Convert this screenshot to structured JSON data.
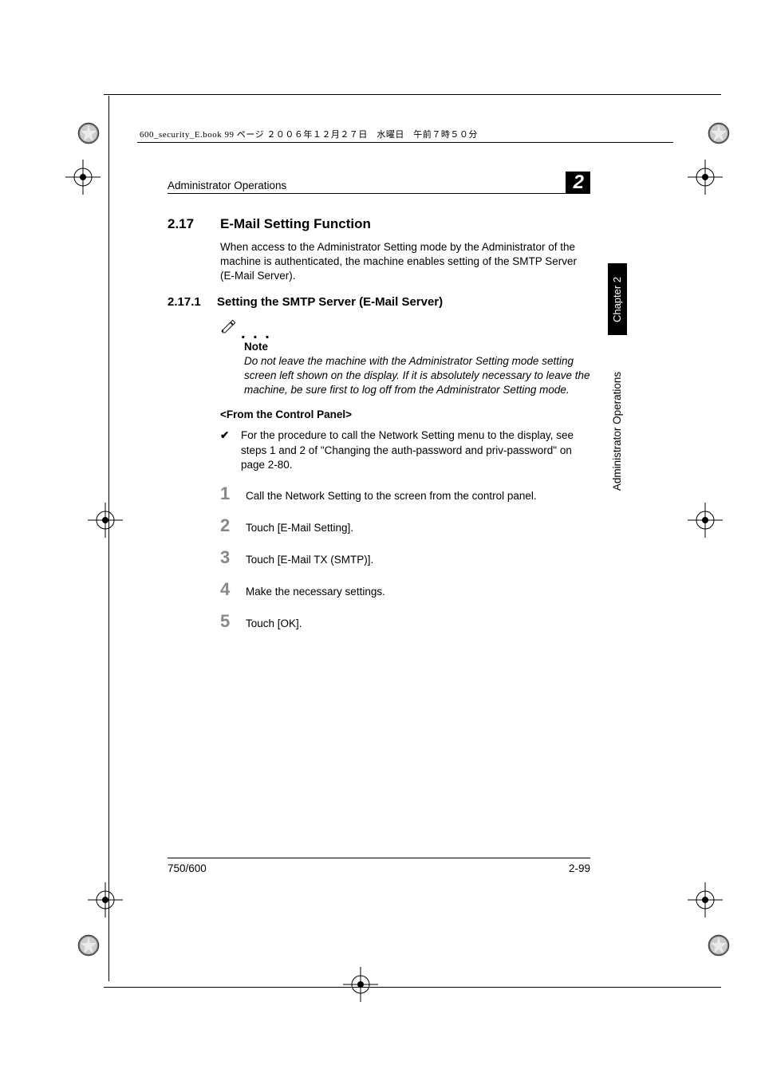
{
  "filename_line": "600_security_E.book  99 ページ  ２００６年１２月２７日　水曜日　午前７時５０分",
  "header": {
    "title": "Administrator Operations",
    "chapter_num": "2"
  },
  "section": {
    "num": "2.17",
    "title": "E-Mail Setting Function",
    "intro": "When access to the Administrator Setting mode by the Administrator of the machine is authenticated, the machine enables setting of the SMTP Server (E-Mail Server)."
  },
  "subsection": {
    "num": "2.17.1",
    "title": "Setting the SMTP Server (E-Mail Server)"
  },
  "note": {
    "label": "Note",
    "body": "Do not leave the machine with the Administrator Setting mode setting screen left shown on the display. If it is absolutely necessary to leave the machine, be sure first to log off from the Administrator Setting mode."
  },
  "subhead": "<From the Control Panel>",
  "check_item": "For the procedure to call the Network Setting menu to the display, see steps 1 and 2 of \"Changing the auth-password and priv-password\" on page 2-80.",
  "steps": [
    {
      "n": "1",
      "t": "Call the Network Setting to the screen from the control panel."
    },
    {
      "n": "2",
      "t": "Touch [E-Mail Setting]."
    },
    {
      "n": "3",
      "t": "Touch [E-Mail TX (SMTP)]."
    },
    {
      "n": "4",
      "t": "Make the necessary settings."
    },
    {
      "n": "5",
      "t": "Touch [OK]."
    }
  ],
  "footer": {
    "left": "750/600",
    "right": "2-99"
  },
  "sidebar": {
    "chapter": "Chapter 2",
    "title": "Administrator Operations"
  }
}
